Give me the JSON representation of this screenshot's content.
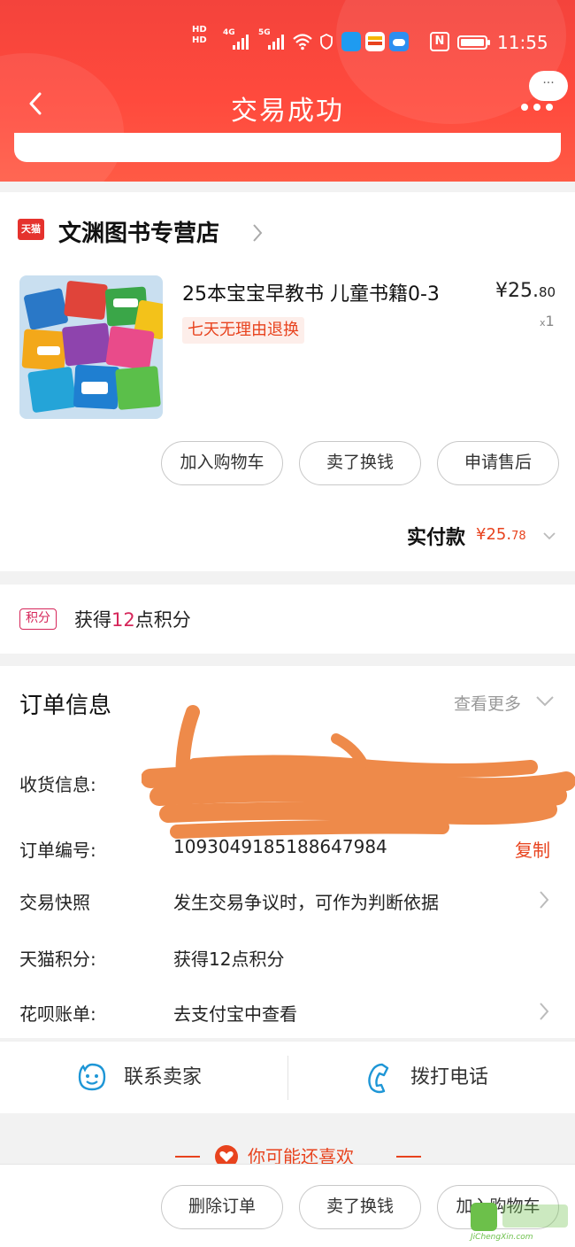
{
  "status_bar": {
    "hd1": "HD",
    "hd2": "HD",
    "net1": "4G",
    "net2": "5G",
    "nfc": "N",
    "time": "11:55"
  },
  "nav": {
    "title": "交易成功",
    "back_icon": "chevron-left-icon",
    "more_icon": "more-dots-icon",
    "more_bubble": "···"
  },
  "store": {
    "logo_text": "天猫",
    "name": "文渊图书专营店"
  },
  "product": {
    "title": "25本宝宝早教书 儿童书籍0-3",
    "price_int": "¥25.",
    "price_dec": "80",
    "qty_prefix": "x",
    "qty": "1",
    "tag": "七天无理由退换"
  },
  "product_actions": {
    "add_cart": "加入购物车",
    "resell": "卖了换钱",
    "after_sale": "申请售后"
  },
  "payment": {
    "label": "实付款",
    "amount_int": "¥25.",
    "amount_dec": "78"
  },
  "points": {
    "badge": "积分",
    "prefix": "获得",
    "value": "12",
    "suffix": "点积分"
  },
  "order_info": {
    "title": "订单信息",
    "view_more": "查看更多",
    "rows": [
      {
        "label": "收货信息:",
        "value": ""
      },
      {
        "label": "订单编号:",
        "value": "1093049185188647984",
        "action": "复制"
      },
      {
        "label": "交易快照",
        "value": "发生交易争议时，可作为判断依据"
      },
      {
        "label": "天猫积分:",
        "value": "获得12点积分"
      },
      {
        "label": "花呗账单:",
        "value": "去支付宝中查看"
      }
    ]
  },
  "contact": {
    "seller": "联系卖家",
    "phone": "拨打电话"
  },
  "recommend": {
    "title": "你可能还喜欢"
  },
  "bottom_actions": {
    "delete": "删除订单",
    "resell": "卖了换钱",
    "add_cart": "加入购物车"
  },
  "colors": {
    "header_red": "#f4433c",
    "accent_orange": "#e8431e",
    "points_pink": "#d6265a",
    "contact_blue": "#1e96d6"
  },
  "watermark": {
    "text": "JiChengXin.com"
  }
}
